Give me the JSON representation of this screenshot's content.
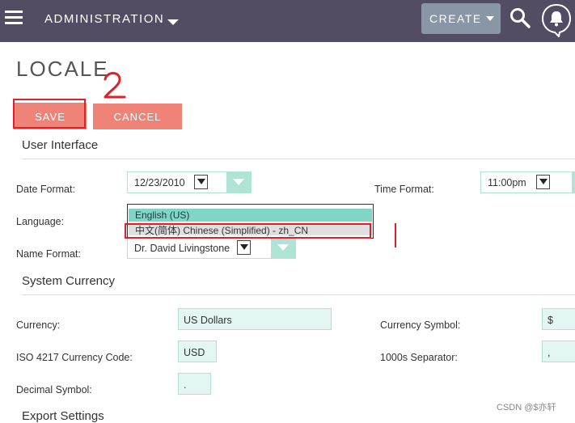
{
  "topbar": {
    "menu_label": "ADMINISTRATION",
    "create_label": "CREATE",
    "menu_icon": "hamburger-icon",
    "search_icon": "search-icon",
    "bell_icon": "bell-icon"
  },
  "page": {
    "title": "LOCALE",
    "annotation_2": "2",
    "save_label": "SAVE",
    "cancel_label": "CANCEL"
  },
  "user_interface": {
    "title": "User Interface",
    "date_format_label": "Date Format:",
    "date_format_value": "12/23/2010",
    "time_format_label": "Time Format:",
    "time_format_value": "11:00pm",
    "language_label": "Language:",
    "language_options": [
      "English (US)",
      "中文(简体) Chinese (Simplified) - zh_CN"
    ],
    "name_format_label": "Name Format:",
    "name_format_value": "Dr. David Livingstone"
  },
  "system_currency": {
    "title": "System Currency",
    "currency_label": "Currency:",
    "currency_value": "US Dollars",
    "currency_symbol_label": "Currency Symbol:",
    "currency_symbol_value": "$",
    "iso_label": "ISO 4217 Currency Code:",
    "iso_value": "USD",
    "thousands_label": "1000s Separator:",
    "thousands_value": ",",
    "decimal_label": "Decimal Symbol:",
    "decimal_value": "."
  },
  "export_settings": {
    "title": "Export Settings"
  },
  "watermark": "CSDN @$亦轩",
  "colors": {
    "topbar": "#534d64",
    "accent_button": "#f08377",
    "mint": "#aee3d6",
    "annotation_red": "#e0202a"
  }
}
